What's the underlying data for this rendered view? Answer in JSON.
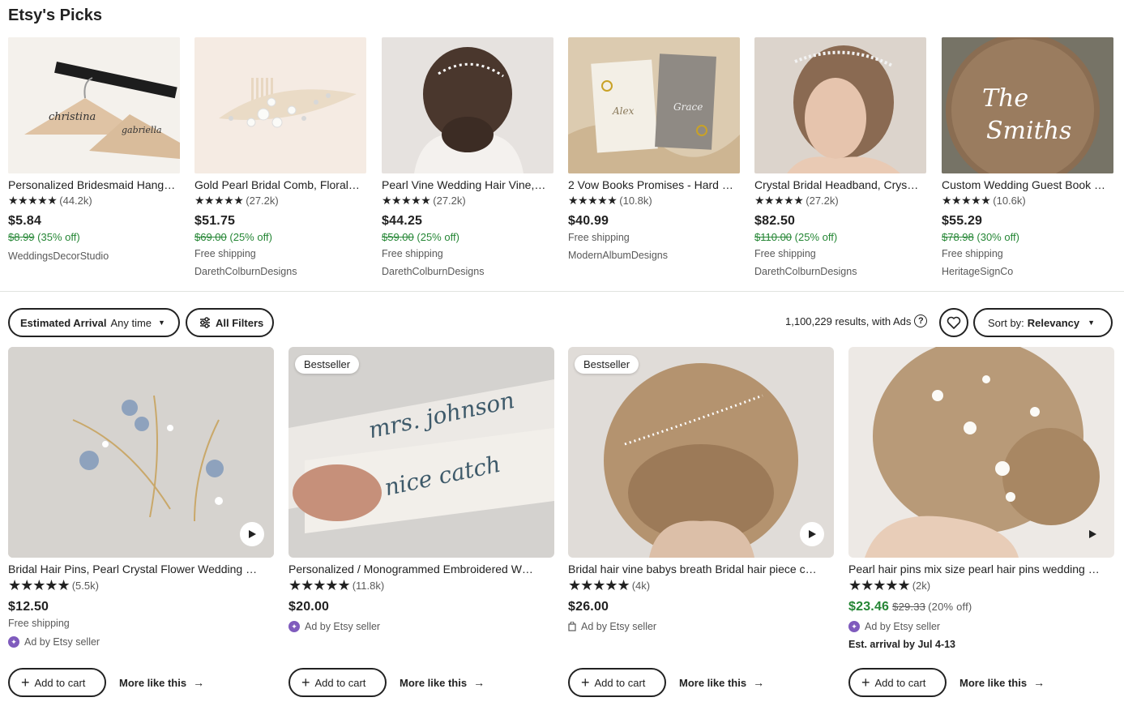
{
  "picks": {
    "title": "Etsy's Picks",
    "items": [
      {
        "title": "Personalized Bridesmaid Hanger…",
        "reviews": "(44.2k)",
        "price": "$5.84",
        "old_price": "$8.99",
        "discount": "(35% off)",
        "shipping": "",
        "shop": "WeddingsDecorStudio"
      },
      {
        "title": "Gold Pearl Bridal Comb, Floral…",
        "reviews": "(27.2k)",
        "price": "$51.75",
        "old_price": "$69.00",
        "discount": "(25% off)",
        "shipping": "Free shipping",
        "shop": "DarethColburnDesigns"
      },
      {
        "title": "Pearl Vine Wedding Hair Vine,…",
        "reviews": "(27.2k)",
        "price": "$44.25",
        "old_price": "$59.00",
        "discount": "(25% off)",
        "shipping": "Free shipping",
        "shop": "DarethColburnDesigns"
      },
      {
        "title": "2 Vow Books Promises - Hard …",
        "reviews": "(10.8k)",
        "price": "$40.99",
        "old_price": "",
        "discount": "",
        "shipping": "Free shipping",
        "shop": "ModernAlbumDesigns"
      },
      {
        "title": "Crystal Bridal Headband, Crys…",
        "reviews": "(27.2k)",
        "price": "$82.50",
        "old_price": "$110.00",
        "discount": "(25% off)",
        "shipping": "Free shipping",
        "shop": "DarethColburnDesigns"
      },
      {
        "title": "Custom Wedding Guest Book …",
        "reviews": "(10.6k)",
        "price": "$55.29",
        "old_price": "$78.98",
        "discount": "(30% off)",
        "shipping": "Free shipping",
        "shop": "HeritageSignCo"
      }
    ]
  },
  "filters": {
    "arrival_label": "Estimated Arrival",
    "arrival_value": "Any time",
    "all_filters": "All Filters",
    "results": "1,100,229 results, with Ads",
    "help": "?",
    "sort_label": "Sort by:",
    "sort_value": "Relevancy"
  },
  "listings": [
    {
      "title": "Bridal Hair Pins, Pearl Crystal Flower Wedding …",
      "badge": "",
      "reviews": "(5.5k)",
      "price": "$12.50",
      "old_price": "",
      "discount": "",
      "shipping": "Free shipping",
      "ad": "Ad by Etsy seller",
      "arrival": "",
      "add_to_cart": "Add to cart",
      "more": "More like this"
    },
    {
      "title": "Personalized / Monogrammed Embroidered W…",
      "badge": "Bestseller",
      "reviews": "(11.8k)",
      "price": "$20.00",
      "old_price": "",
      "discount": "",
      "shipping": "",
      "ad": "Ad by Etsy seller",
      "arrival": "",
      "add_to_cart": "Add to cart",
      "more": "More like this"
    },
    {
      "title": "Bridal hair vine babys breath Bridal hair piece c…",
      "badge": "Bestseller",
      "reviews": "(4k)",
      "price": "$26.00",
      "old_price": "",
      "discount": "",
      "shipping": "",
      "ad": "Ad by Etsy seller",
      "arrival": "",
      "add_to_cart": "Add to cart",
      "more": "More like this"
    },
    {
      "title": "Pearl hair pins mix size pearl hair pins wedding …",
      "badge": "",
      "reviews": "(2k)",
      "price": "$23.46",
      "old_price": "$29.33",
      "discount": "(20% off)",
      "shipping": "",
      "ad": "Ad by Etsy seller",
      "arrival": "Est. arrival by Jul 4-13",
      "add_to_cart": "Add to cart",
      "more": "More like this"
    }
  ],
  "stars": "★★★★★",
  "colors": {
    "sale_green": "#258635",
    "text": "#222222",
    "muted": "#595959",
    "ad_purple": "#7f5bbd"
  }
}
